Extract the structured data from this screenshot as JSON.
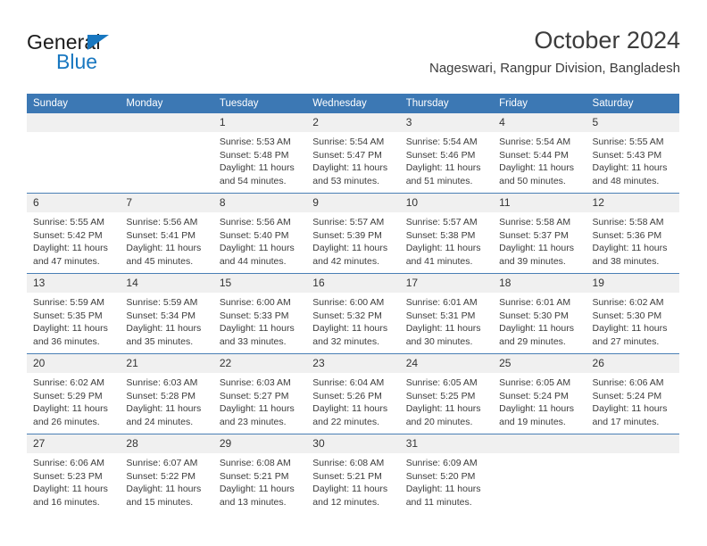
{
  "logo": {
    "word_top": "General",
    "word_bottom": "Blue",
    "triangle_icon": "blue-triangle-icon",
    "brand_color": "#1877c0"
  },
  "header": {
    "title": "October 2024",
    "subtitle": "Nageswari, Rangpur Division, Bangladesh"
  },
  "theme": {
    "header_blue": "#3c78b4",
    "daynum_gray": "#f0f0f0",
    "divider_blue": "#4a7fb5",
    "text": "#333333"
  },
  "calendar": {
    "weekday_headers": [
      "Sunday",
      "Monday",
      "Tuesday",
      "Wednesday",
      "Thursday",
      "Friday",
      "Saturday"
    ],
    "weeks": [
      [
        {
          "day": "",
          "sunrise": "",
          "sunset": "",
          "daylight": ""
        },
        {
          "day": "",
          "sunrise": "",
          "sunset": "",
          "daylight": ""
        },
        {
          "day": "1",
          "sunrise": "Sunrise: 5:53 AM",
          "sunset": "Sunset: 5:48 PM",
          "daylight": "Daylight: 11 hours and 54 minutes."
        },
        {
          "day": "2",
          "sunrise": "Sunrise: 5:54 AM",
          "sunset": "Sunset: 5:47 PM",
          "daylight": "Daylight: 11 hours and 53 minutes."
        },
        {
          "day": "3",
          "sunrise": "Sunrise: 5:54 AM",
          "sunset": "Sunset: 5:46 PM",
          "daylight": "Daylight: 11 hours and 51 minutes."
        },
        {
          "day": "4",
          "sunrise": "Sunrise: 5:54 AM",
          "sunset": "Sunset: 5:44 PM",
          "daylight": "Daylight: 11 hours and 50 minutes."
        },
        {
          "day": "5",
          "sunrise": "Sunrise: 5:55 AM",
          "sunset": "Sunset: 5:43 PM",
          "daylight": "Daylight: 11 hours and 48 minutes."
        }
      ],
      [
        {
          "day": "6",
          "sunrise": "Sunrise: 5:55 AM",
          "sunset": "Sunset: 5:42 PM",
          "daylight": "Daylight: 11 hours and 47 minutes."
        },
        {
          "day": "7",
          "sunrise": "Sunrise: 5:56 AM",
          "sunset": "Sunset: 5:41 PM",
          "daylight": "Daylight: 11 hours and 45 minutes."
        },
        {
          "day": "8",
          "sunrise": "Sunrise: 5:56 AM",
          "sunset": "Sunset: 5:40 PM",
          "daylight": "Daylight: 11 hours and 44 minutes."
        },
        {
          "day": "9",
          "sunrise": "Sunrise: 5:57 AM",
          "sunset": "Sunset: 5:39 PM",
          "daylight": "Daylight: 11 hours and 42 minutes."
        },
        {
          "day": "10",
          "sunrise": "Sunrise: 5:57 AM",
          "sunset": "Sunset: 5:38 PM",
          "daylight": "Daylight: 11 hours and 41 minutes."
        },
        {
          "day": "11",
          "sunrise": "Sunrise: 5:58 AM",
          "sunset": "Sunset: 5:37 PM",
          "daylight": "Daylight: 11 hours and 39 minutes."
        },
        {
          "day": "12",
          "sunrise": "Sunrise: 5:58 AM",
          "sunset": "Sunset: 5:36 PM",
          "daylight": "Daylight: 11 hours and 38 minutes."
        }
      ],
      [
        {
          "day": "13",
          "sunrise": "Sunrise: 5:59 AM",
          "sunset": "Sunset: 5:35 PM",
          "daylight": "Daylight: 11 hours and 36 minutes."
        },
        {
          "day": "14",
          "sunrise": "Sunrise: 5:59 AM",
          "sunset": "Sunset: 5:34 PM",
          "daylight": "Daylight: 11 hours and 35 minutes."
        },
        {
          "day": "15",
          "sunrise": "Sunrise: 6:00 AM",
          "sunset": "Sunset: 5:33 PM",
          "daylight": "Daylight: 11 hours and 33 minutes."
        },
        {
          "day": "16",
          "sunrise": "Sunrise: 6:00 AM",
          "sunset": "Sunset: 5:32 PM",
          "daylight": "Daylight: 11 hours and 32 minutes."
        },
        {
          "day": "17",
          "sunrise": "Sunrise: 6:01 AM",
          "sunset": "Sunset: 5:31 PM",
          "daylight": "Daylight: 11 hours and 30 minutes."
        },
        {
          "day": "18",
          "sunrise": "Sunrise: 6:01 AM",
          "sunset": "Sunset: 5:30 PM",
          "daylight": "Daylight: 11 hours and 29 minutes."
        },
        {
          "day": "19",
          "sunrise": "Sunrise: 6:02 AM",
          "sunset": "Sunset: 5:30 PM",
          "daylight": "Daylight: 11 hours and 27 minutes."
        }
      ],
      [
        {
          "day": "20",
          "sunrise": "Sunrise: 6:02 AM",
          "sunset": "Sunset: 5:29 PM",
          "daylight": "Daylight: 11 hours and 26 minutes."
        },
        {
          "day": "21",
          "sunrise": "Sunrise: 6:03 AM",
          "sunset": "Sunset: 5:28 PM",
          "daylight": "Daylight: 11 hours and 24 minutes."
        },
        {
          "day": "22",
          "sunrise": "Sunrise: 6:03 AM",
          "sunset": "Sunset: 5:27 PM",
          "daylight": "Daylight: 11 hours and 23 minutes."
        },
        {
          "day": "23",
          "sunrise": "Sunrise: 6:04 AM",
          "sunset": "Sunset: 5:26 PM",
          "daylight": "Daylight: 11 hours and 22 minutes."
        },
        {
          "day": "24",
          "sunrise": "Sunrise: 6:05 AM",
          "sunset": "Sunset: 5:25 PM",
          "daylight": "Daylight: 11 hours and 20 minutes."
        },
        {
          "day": "25",
          "sunrise": "Sunrise: 6:05 AM",
          "sunset": "Sunset: 5:24 PM",
          "daylight": "Daylight: 11 hours and 19 minutes."
        },
        {
          "day": "26",
          "sunrise": "Sunrise: 6:06 AM",
          "sunset": "Sunset: 5:24 PM",
          "daylight": "Daylight: 11 hours and 17 minutes."
        }
      ],
      [
        {
          "day": "27",
          "sunrise": "Sunrise: 6:06 AM",
          "sunset": "Sunset: 5:23 PM",
          "daylight": "Daylight: 11 hours and 16 minutes."
        },
        {
          "day": "28",
          "sunrise": "Sunrise: 6:07 AM",
          "sunset": "Sunset: 5:22 PM",
          "daylight": "Daylight: 11 hours and 15 minutes."
        },
        {
          "day": "29",
          "sunrise": "Sunrise: 6:08 AM",
          "sunset": "Sunset: 5:21 PM",
          "daylight": "Daylight: 11 hours and 13 minutes."
        },
        {
          "day": "30",
          "sunrise": "Sunrise: 6:08 AM",
          "sunset": "Sunset: 5:21 PM",
          "daylight": "Daylight: 11 hours and 12 minutes."
        },
        {
          "day": "31",
          "sunrise": "Sunrise: 6:09 AM",
          "sunset": "Sunset: 5:20 PM",
          "daylight": "Daylight: 11 hours and 11 minutes."
        },
        {
          "day": "",
          "sunrise": "",
          "sunset": "",
          "daylight": ""
        },
        {
          "day": "",
          "sunrise": "",
          "sunset": "",
          "daylight": ""
        }
      ]
    ]
  }
}
